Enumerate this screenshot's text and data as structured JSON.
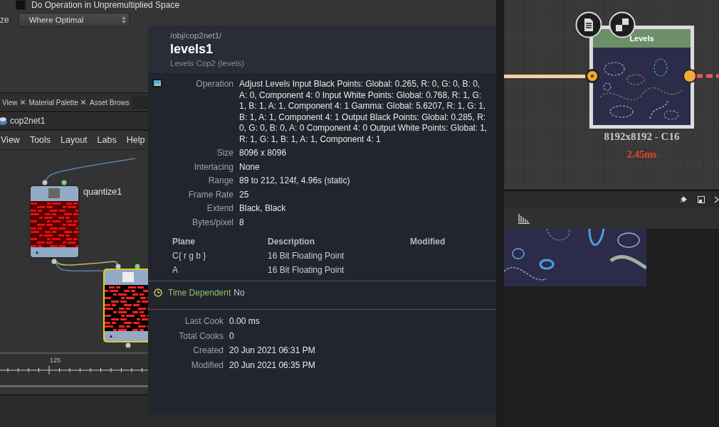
{
  "params": {
    "partial_label": "ze",
    "checkbox": {
      "label": "Do Operation in Unpremultiplied Space",
      "checked": false
    },
    "dropdown": "Where Optimal"
  },
  "pane_tabs": [
    {
      "label": "View",
      "has_close": true
    },
    {
      "label": "Material Palette",
      "has_close": true
    },
    {
      "label": "Asset Brows",
      "has_close": false
    }
  ],
  "network": {
    "path": "cop2net1",
    "menu": [
      "View",
      "Tools",
      "Layout",
      "Labs",
      "Help"
    ],
    "nodes": [
      {
        "name": "quantize1",
        "selected": false
      },
      {
        "selected": true
      }
    ]
  },
  "timeline": {
    "tick_label": "125"
  },
  "info": {
    "path": "/obj/cop2net1/",
    "title": "levels1",
    "subtitle": "Levels Cop2 (levels)",
    "properties": [
      {
        "label": "Operation",
        "value": "Adjust Levels Input Black Points: Global: 0.265, R: 0, G: 0, B: 0, A: 0, Component 4: 0 Input White Points: Global: 0.768, R: 1, G: 1, B: 1, A: 1, Component 4: 1 Gamma: Global: 5.6207, R: 1, G: 1, B: 1, A: 1, Component 4: 1 Output Black Points: Global: 0.285, R: 0, G: 0, B: 0, A: 0 Component 4: 0 Output White Points: Global: 1, R: 1, G: 1, B: 1, A: 1, Component 4: 1"
      },
      {
        "label": "Size",
        "value": "8096 x 8096"
      },
      {
        "label": "Interlacing",
        "value": "None"
      },
      {
        "label": "Range",
        "value": "89 to 212, 124f, 4.96s (static)"
      },
      {
        "label": "Frame Rate",
        "value": "25"
      },
      {
        "label": "Extend",
        "value": "Black, Black"
      },
      {
        "label": "Bytes/pixel",
        "value": "8"
      }
    ],
    "planes": {
      "columns": [
        "Plane",
        "Description",
        "Modified"
      ],
      "rows": [
        [
          "C{ r g b }",
          "16 Bit Floating Point"
        ],
        [
          "A",
          "16 Bit Floating Point"
        ]
      ]
    },
    "time_dependent": {
      "label": "Time Dependent",
      "value": "No"
    },
    "cook": [
      {
        "label": "Last Cook",
        "value": "0.00 ms"
      },
      {
        "label": "Total Cooks",
        "value": "0"
      },
      {
        "label": "Created",
        "value": "20 Jun 2021 06:31 PM"
      },
      {
        "label": "Modified",
        "value": "20 Jun 2021 06:35 PM"
      }
    ]
  },
  "graph": {
    "node": {
      "title": "Levels",
      "resolution": "8192x8192 - C16",
      "time": "2.45ms"
    }
  }
}
